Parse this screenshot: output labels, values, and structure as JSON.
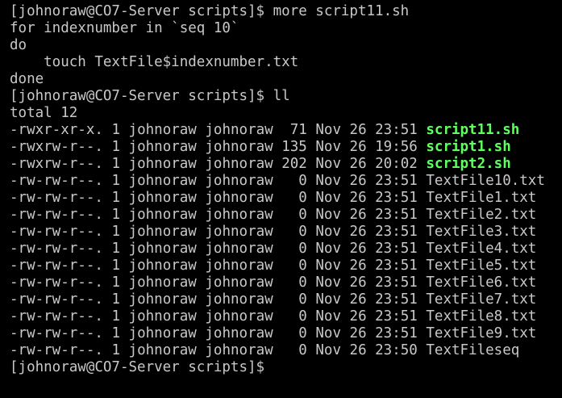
{
  "colors": {
    "background": "#000000",
    "text": "#c8c8c8",
    "executable": "#5fff5f"
  },
  "terminal": {
    "lines": [
      "[johnoraw@CO7-Server scripts]$ more script11.sh",
      "for indexnumber in `seq 10`",
      "do",
      "    touch TextFile$indexnumber.txt",
      "done",
      "[johnoraw@CO7-Server scripts]$ ll",
      "total 12"
    ],
    "listing": [
      {
        "perms": "-rwxr-xr-x.",
        "links": "1",
        "owner": "johnoraw",
        "group": "johnoraw",
        "size": " 71",
        "date": "Nov 26 23:51",
        "name": "script11.sh",
        "executable": true
      },
      {
        "perms": "-rwxrw-r--.",
        "links": "1",
        "owner": "johnoraw",
        "group": "johnoraw",
        "size": "135",
        "date": "Nov 26 19:56",
        "name": "script1.sh",
        "executable": true
      },
      {
        "perms": "-rwxrw-r--.",
        "links": "1",
        "owner": "johnoraw",
        "group": "johnoraw",
        "size": "202",
        "date": "Nov 26 20:02",
        "name": "script2.sh",
        "executable": true
      },
      {
        "perms": "-rw-rw-r--.",
        "links": "1",
        "owner": "johnoraw",
        "group": "johnoraw",
        "size": "  0",
        "date": "Nov 26 23:51",
        "name": "TextFile10.txt",
        "executable": false
      },
      {
        "perms": "-rw-rw-r--.",
        "links": "1",
        "owner": "johnoraw",
        "group": "johnoraw",
        "size": "  0",
        "date": "Nov 26 23:51",
        "name": "TextFile1.txt",
        "executable": false
      },
      {
        "perms": "-rw-rw-r--.",
        "links": "1",
        "owner": "johnoraw",
        "group": "johnoraw",
        "size": "  0",
        "date": "Nov 26 23:51",
        "name": "TextFile2.txt",
        "executable": false
      },
      {
        "perms": "-rw-rw-r--.",
        "links": "1",
        "owner": "johnoraw",
        "group": "johnoraw",
        "size": "  0",
        "date": "Nov 26 23:51",
        "name": "TextFile3.txt",
        "executable": false
      },
      {
        "perms": "-rw-rw-r--.",
        "links": "1",
        "owner": "johnoraw",
        "group": "johnoraw",
        "size": "  0",
        "date": "Nov 26 23:51",
        "name": "TextFile4.txt",
        "executable": false
      },
      {
        "perms": "-rw-rw-r--.",
        "links": "1",
        "owner": "johnoraw",
        "group": "johnoraw",
        "size": "  0",
        "date": "Nov 26 23:51",
        "name": "TextFile5.txt",
        "executable": false
      },
      {
        "perms": "-rw-rw-r--.",
        "links": "1",
        "owner": "johnoraw",
        "group": "johnoraw",
        "size": "  0",
        "date": "Nov 26 23:51",
        "name": "TextFile6.txt",
        "executable": false
      },
      {
        "perms": "-rw-rw-r--.",
        "links": "1",
        "owner": "johnoraw",
        "group": "johnoraw",
        "size": "  0",
        "date": "Nov 26 23:51",
        "name": "TextFile7.txt",
        "executable": false
      },
      {
        "perms": "-rw-rw-r--.",
        "links": "1",
        "owner": "johnoraw",
        "group": "johnoraw",
        "size": "  0",
        "date": "Nov 26 23:51",
        "name": "TextFile8.txt",
        "executable": false
      },
      {
        "perms": "-rw-rw-r--.",
        "links": "1",
        "owner": "johnoraw",
        "group": "johnoraw",
        "size": "  0",
        "date": "Nov 26 23:51",
        "name": "TextFile9.txt",
        "executable": false
      },
      {
        "perms": "-rw-rw-r--.",
        "links": "1",
        "owner": "johnoraw",
        "group": "johnoraw",
        "size": "  0",
        "date": "Nov 26 23:50",
        "name": "TextFileseq",
        "executable": false
      }
    ],
    "final_prompt": "[johnoraw@CO7-Server scripts]$"
  }
}
